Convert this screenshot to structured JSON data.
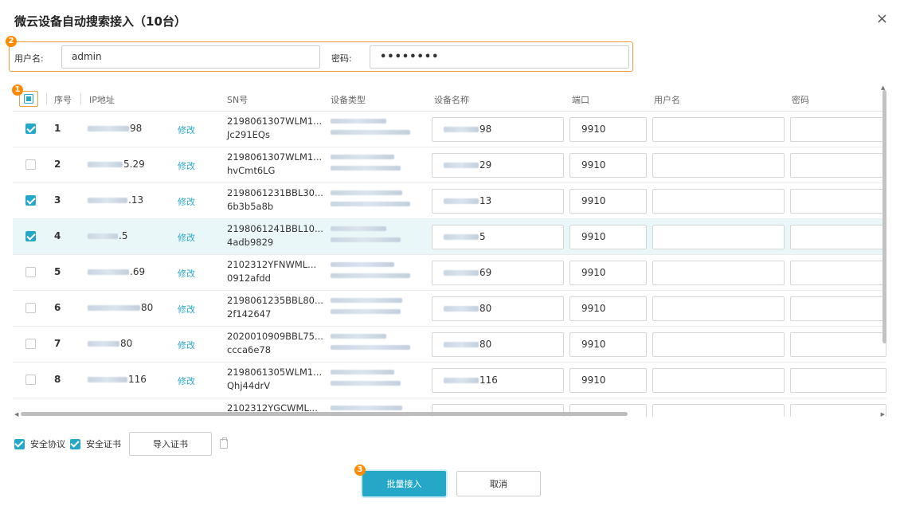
{
  "dialog": {
    "title": "微云设备自动搜索接入（10台）",
    "close_icon": "×"
  },
  "markers": {
    "m1": "1",
    "m2": "2",
    "m3": "3"
  },
  "credentials": {
    "username_label": "用户名:",
    "username_value": "admin",
    "password_label": "密码:",
    "password_value": "••••••••"
  },
  "table": {
    "headers": {
      "index": "序号",
      "ip": "IP地址",
      "sn": "SN号",
      "type": "设备类型",
      "name": "设备名称",
      "port": "端口",
      "username": "用户名",
      "password": "密码"
    },
    "edit_label": "修改",
    "rows": [
      {
        "index": "1",
        "ip_suffix": "98",
        "sn1": "2198061307WLM1...",
        "sn2": "Jc291EQs",
        "name_suffix": "98",
        "port": "9910",
        "checked": true,
        "highlight": false
      },
      {
        "index": "2",
        "ip_suffix": "5.29",
        "sn1": "2198061307WLM1...",
        "sn2": "hvCmt6LG",
        "name_suffix": "29",
        "port": "9910",
        "checked": false,
        "highlight": false
      },
      {
        "index": "3",
        "ip_suffix": ".13",
        "sn1": "2198061231BBL30...",
        "sn2": "6b3b5a8b",
        "name_suffix": "13",
        "port": "9910",
        "checked": true,
        "highlight": false
      },
      {
        "index": "4",
        "ip_suffix": ".5",
        "sn1": "2198061241BBL10...",
        "sn2": "4adb9829",
        "name_suffix": "5",
        "port": "9910",
        "checked": true,
        "highlight": true
      },
      {
        "index": "5",
        "ip_suffix": ".69",
        "sn1": "2102312YFNWML...",
        "sn2": "0912afdd",
        "name_suffix": "69",
        "port": "9910",
        "checked": false,
        "highlight": false
      },
      {
        "index": "6",
        "ip_suffix": "80",
        "sn1": "2198061235BBL80...",
        "sn2": "2f142647",
        "name_suffix": "80",
        "port": "9910",
        "checked": false,
        "highlight": false
      },
      {
        "index": "7",
        "ip_suffix": "80",
        "sn1": "2020010909BBL75...",
        "sn2": "ccca6e78",
        "name_suffix": "80",
        "port": "9910",
        "checked": false,
        "highlight": false
      },
      {
        "index": "8",
        "ip_suffix": "116",
        "sn1": "2198061305WLM1...",
        "sn2": "Qhj44drV",
        "name_suffix": "116",
        "port": "9910",
        "checked": false,
        "highlight": false
      },
      {
        "index": "",
        "ip_suffix": "",
        "sn1": "2102312YGCWML...",
        "sn2": "",
        "name_suffix": "",
        "port": "",
        "checked": false,
        "highlight": false
      }
    ]
  },
  "options": {
    "security_protocol": "安全协议",
    "security_cert": "安全证书",
    "import_cert": "导入证书"
  },
  "actions": {
    "batch_connect": "批量接入",
    "cancel": "取消"
  },
  "colors": {
    "accent": "#25a8c8",
    "highlight_border": "#f39c3c",
    "marker": "#ff8a00"
  }
}
